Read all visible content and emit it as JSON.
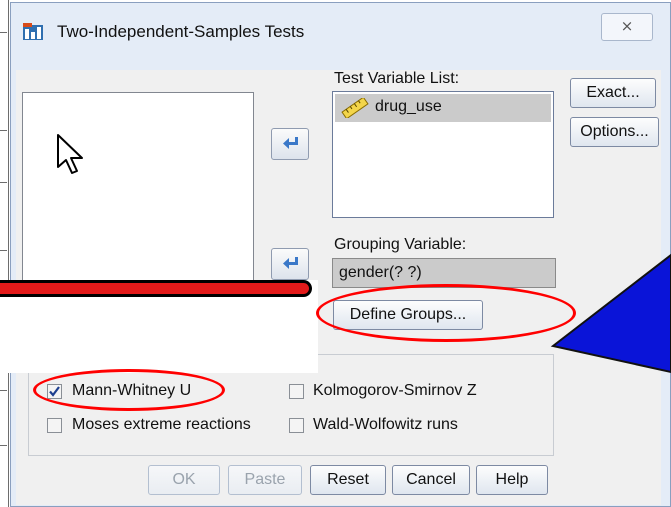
{
  "window": {
    "title": "Two-Independent-Samples Tests",
    "close_glyph": "⨯"
  },
  "source_list": {
    "items": []
  },
  "test_variable_list": {
    "label": "Test Variable List:",
    "items": [
      "drug_use"
    ]
  },
  "grouping_variable": {
    "label": "Grouping Variable:",
    "value": "gender(? ?)"
  },
  "buttons": {
    "exact": "Exact...",
    "options": "Options...",
    "define_groups": "Define Groups...",
    "ok": "OK",
    "paste": "Paste",
    "reset": "Reset",
    "cancel": "Cancel",
    "help": "Help"
  },
  "test_type": {
    "options": [
      {
        "label": "Mann-Whitney U",
        "checked": true
      },
      {
        "label": "Kolmogorov-Smirnov Z",
        "checked": false
      },
      {
        "label": "Moses extreme reactions",
        "checked": false
      },
      {
        "label": "Wald-Wolfowitz runs",
        "checked": false
      }
    ]
  },
  "colors": {
    "annotation_red": "#ff0000",
    "callout_blue": "#0a14d8",
    "dialog_background": "#f0f0f0",
    "selection_gray": "#cbcbcb"
  }
}
